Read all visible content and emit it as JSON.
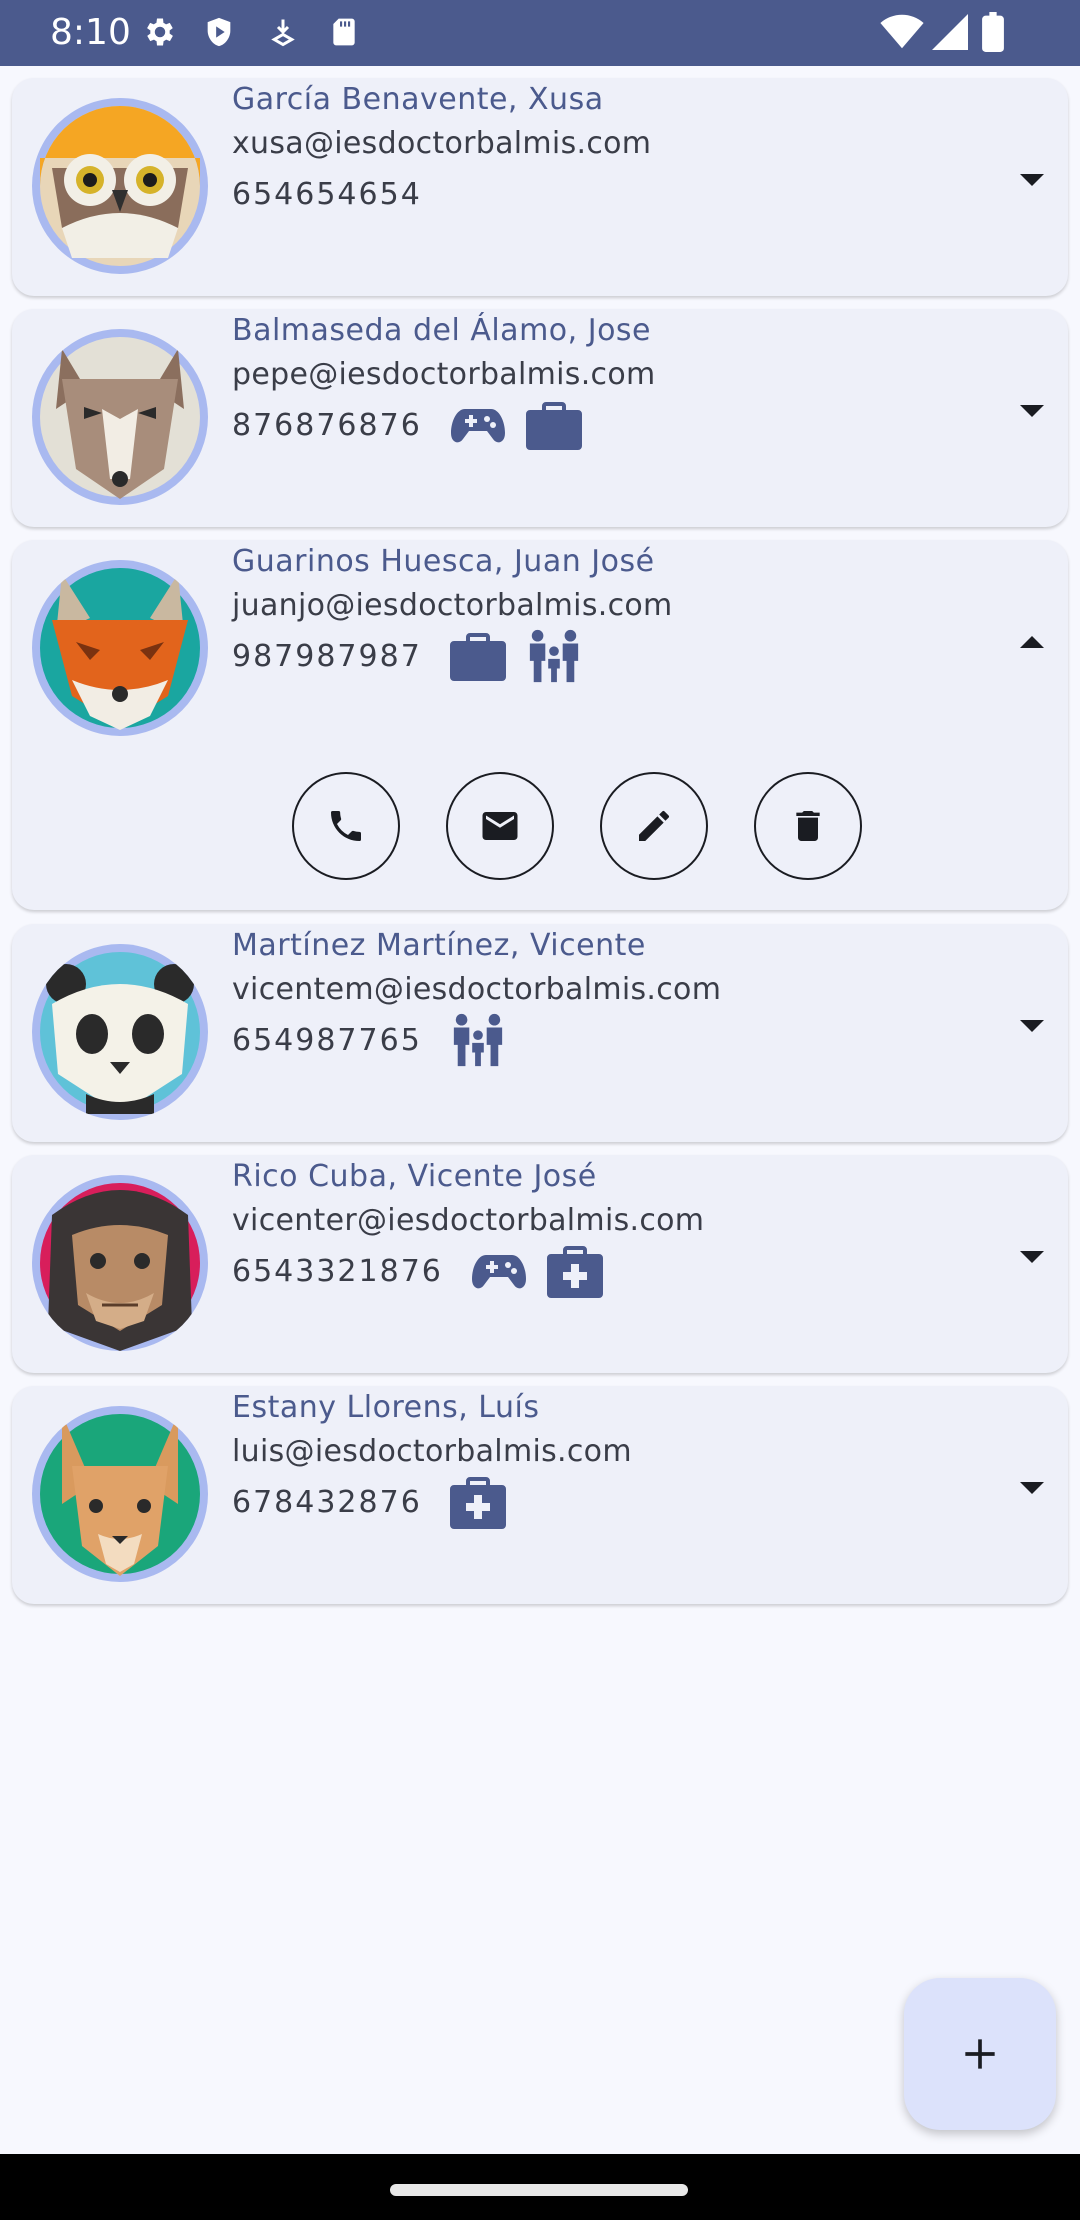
{
  "status_bar": {
    "time": "8:10",
    "left_icons": [
      "gear-icon",
      "shield-icon",
      "download-arrow-icon",
      "sd-card-icon"
    ],
    "right_icons": [
      "wifi-icon",
      "signal-icon",
      "battery-icon"
    ]
  },
  "colors": {
    "primary": "#4b5a8d",
    "card_bg": "#eef0f9",
    "avatar_ring": "#a9b9f0",
    "fab_bg": "#dce2fb"
  },
  "contacts": [
    {
      "name": "García Benavente, Xusa",
      "email": "xusa@iesdoctorbalmis.com",
      "phone": "654654654",
      "tags": [],
      "expanded": false,
      "avatar": "owl-avatar"
    },
    {
      "name": "Balmaseda del Álamo, Jose",
      "email": "pepe@iesdoctorbalmis.com",
      "phone": "876876876",
      "tags": [
        "gamepad-icon",
        "briefcase-icon"
      ],
      "expanded": false,
      "avatar": "wolf-avatar"
    },
    {
      "name": "Guarinos Huesca, Juan José",
      "email": "juanjo@iesdoctorbalmis.com",
      "phone": "987987987",
      "tags": [
        "briefcase-icon",
        "family-icon"
      ],
      "expanded": true,
      "avatar": "fox-avatar"
    },
    {
      "name": "Martínez Martínez, Vicente",
      "email": "vicentem@iesdoctorbalmis.com",
      "phone": "654987765",
      "tags": [
        "family-icon"
      ],
      "expanded": false,
      "avatar": "panda-avatar"
    },
    {
      "name": "Rico Cuba, Vicente José",
      "email": "vicenter@iesdoctorbalmis.com",
      "phone": "6543321876",
      "tags": [
        "gamepad-icon",
        "medical-kit-icon"
      ],
      "expanded": false,
      "avatar": "chimp-avatar"
    },
    {
      "name": "Estany Llorens, Luís",
      "email": "luis@iesdoctorbalmis.com",
      "phone": "678432876",
      "tags": [
        "medical-kit-icon"
      ],
      "expanded": false,
      "avatar": "kangaroo-avatar"
    }
  ],
  "expanded_actions": [
    "phone-icon",
    "mail-icon",
    "edit-pencil-icon",
    "delete-trash-icon"
  ],
  "fab": {
    "icon": "plus-icon"
  }
}
